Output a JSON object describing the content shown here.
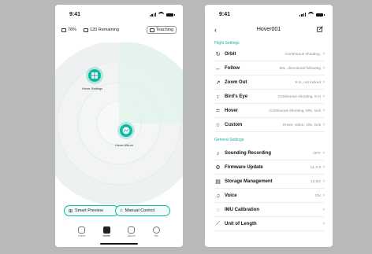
{
  "phone1": {
    "status": {
      "time": "9:41"
    },
    "topbar": {
      "battery": "78%",
      "storage": "120 Remaining",
      "teaching": "Teaching"
    },
    "points": {
      "hover_settings": "Hover Settings",
      "hover_album": "Hover Album"
    },
    "buttons": {
      "smart_preview": "Smart Preview",
      "manual_control": "Manual Control"
    },
    "nav": [
      {
        "label": "Home",
        "icon": "home-icon"
      },
      {
        "label": "Hover",
        "icon": "hover-icon"
      },
      {
        "label": "Album",
        "icon": "album-icon"
      },
      {
        "label": "Me",
        "icon": "me-icon"
      }
    ],
    "accent": "#0fb8a5"
  },
  "phone2": {
    "status": {
      "time": "9:41"
    },
    "header": {
      "title": "Hover001"
    },
    "flight_title": "Flight Settings",
    "flight": [
      {
        "label": "Orbit",
        "value": "Continuous shooting,",
        "icon": "orbit-icon"
      },
      {
        "label": "Follow",
        "value": "60L, directional following",
        "icon": "follow-icon"
      },
      {
        "label": "Zoom Out",
        "value": "9 m, not locked",
        "icon": "zoom-out-icon"
      },
      {
        "label": "Bird's Eye",
        "value": "Continuous shooting, 9 m",
        "icon": "birds-eye-icon"
      },
      {
        "label": "Hover",
        "value": "Continuous shooting, 60s, lock",
        "icon": "hover-icon"
      },
      {
        "label": "Custom",
        "value": "Hover, video, 10s, lock",
        "icon": "custom-icon"
      }
    ],
    "general_title": "General Settings",
    "general": [
      {
        "label": "Sounding Recording",
        "value": "OFF",
        "icon": "mic-icon"
      },
      {
        "label": "Firmware Update",
        "value": "v1.2.3",
        "icon": "firmware-icon"
      },
      {
        "label": "Storage Management",
        "value": "12.5G",
        "icon": "storage-icon"
      },
      {
        "label": "Voice",
        "value": "ON",
        "icon": "voice-icon"
      },
      {
        "label": "IMU Calibration",
        "value": "",
        "icon": "imu-icon"
      },
      {
        "label": "Unit of Length",
        "value": "",
        "icon": "ruler-icon"
      }
    ]
  }
}
